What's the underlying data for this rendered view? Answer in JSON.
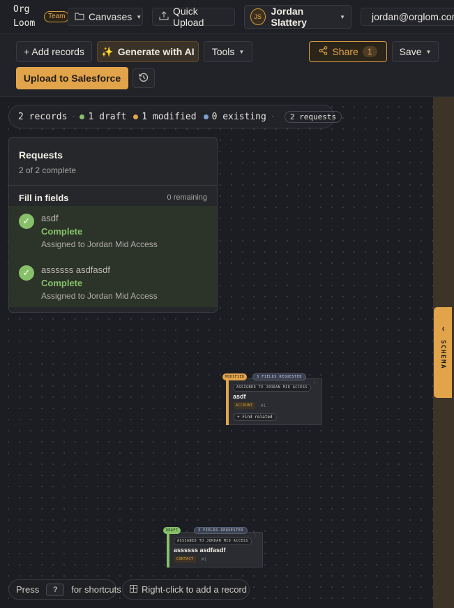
{
  "header": {
    "logo": "Org Loom",
    "team_badge": "Team",
    "canvases_label": "Canvases",
    "quick_upload_label": "Quick Upload",
    "user": {
      "initials": "JS",
      "name": "Jordan Slattery"
    },
    "email": "jordan@orglom.com",
    "email_status_color": "#86c169"
  },
  "toolbar": {
    "add_records_label": "+ Add records",
    "generate_ai_label": "Generate with AI",
    "tools_label": "Tools",
    "share_label": "Share",
    "share_count": "1",
    "save_label": "Save",
    "upload_label": "Upload to Salesforce"
  },
  "status": {
    "records": "2 records",
    "draft": "1 draft",
    "modified": "1 modified",
    "existing": "0 existing",
    "requests": "2 requests",
    "colors": {
      "draft": "#86c169",
      "modified": "#e2a44a",
      "existing": "#7f9fd0"
    }
  },
  "requests_panel": {
    "title": "Requests",
    "subtitle": "2 of 2 complete",
    "section_title": "Fill in fields",
    "remaining": "0 remaining",
    "items": [
      {
        "name": "asdf",
        "status": "Complete",
        "assigned": "Assigned to Jordan Mid Access"
      },
      {
        "name": "assssss asdfasdf",
        "status": "Complete",
        "assigned": "Assigned to Jordan Mid Access"
      }
    ]
  },
  "cards": [
    {
      "state_tag": "MODIFIED",
      "fields_tag": "3 FIELDS REQUESTED",
      "assigned": "ASSIGNED TO JORDAN MID ACCESS",
      "name": "asdf",
      "type": "ACCOUNT",
      "index": "#1",
      "find_related": "+ Find related",
      "edge_color": "#e2a44a"
    },
    {
      "state_tag": "DRAFT",
      "fields_tag": "3 FIELDS REQUESTED",
      "assigned": "ASSIGNED TO JORDAN MID ACCESS",
      "name": "assssss asdfasdf",
      "type": "CONTACT",
      "index": "#1",
      "edge_color": "#86c169"
    }
  ],
  "schema_tab": {
    "label": "SCHEMA",
    "chevron": "‹"
  },
  "hints": {
    "press": "Press",
    "key": "?",
    "shortcuts": "for shortcuts",
    "right_click": "Right-click to add a record"
  }
}
